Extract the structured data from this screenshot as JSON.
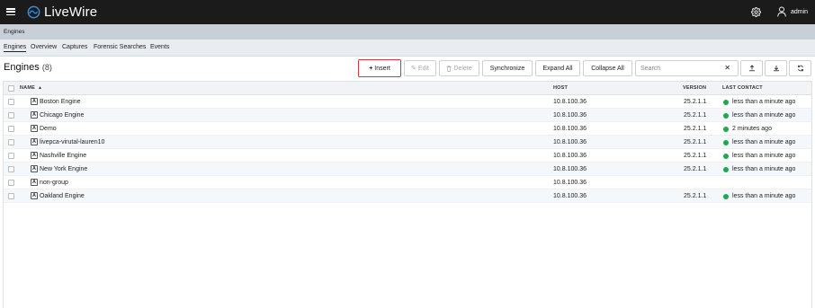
{
  "app": {
    "title": "LiveWire",
    "user": "admin"
  },
  "breadcrumb": "Engines",
  "tabs": [
    {
      "label": "Engines",
      "active": true
    },
    {
      "label": "Overview",
      "active": false
    },
    {
      "label": "Captures",
      "active": false
    },
    {
      "label": "Forensic Searches",
      "active": false
    },
    {
      "label": "Events",
      "active": false
    }
  ],
  "page": {
    "title": "Engines",
    "count": "(8)"
  },
  "toolbar": {
    "insert": "Insert",
    "edit": "Edit",
    "delete": "Delete",
    "synchronize": "Synchronize",
    "expand_all": "Expand All",
    "collapse_all": "Collapse All",
    "search_placeholder": "Search",
    "clear_glyph": "✕"
  },
  "columns": {
    "name": "NAME",
    "host": "HOST",
    "version": "VERSION",
    "last_contact": "LAST CONTACT"
  },
  "rows": [
    {
      "name": "Boston Engine",
      "host": "10.8.100.36",
      "version": "25.2.1.1",
      "last_contact": "less than a minute ago"
    },
    {
      "name": "Chicago Engine",
      "host": "10.8.100.36",
      "version": "25.2.1.1",
      "last_contact": "less than a minute ago"
    },
    {
      "name": "Demo",
      "host": "10.8.100.36",
      "version": "25.2.1.1",
      "last_contact": "2 minutes ago"
    },
    {
      "name": "livepca-virutal-lauren10",
      "host": "10.8.100.36",
      "version": "25.2.1.1",
      "last_contact": "less than a minute ago"
    },
    {
      "name": "Nashville Engine",
      "host": "10.8.100.36",
      "version": "25.2.1.1",
      "last_contact": "less than a minute ago"
    },
    {
      "name": "New York Engine",
      "host": "10.8.100.36",
      "version": "25.2.1.1",
      "last_contact": "less than a minute ago"
    },
    {
      "name": "non-group",
      "host": "10.8.100.36",
      "version": "",
      "last_contact": ""
    },
    {
      "name": "Oakland Engine",
      "host": "10.8.100.36",
      "version": "25.2.1.1",
      "last_contact": "less than a minute ago"
    }
  ],
  "icons": {
    "menu": "hamburger-icon",
    "logo": "livewire-logo",
    "settings": "gear-icon",
    "user": "user-icon",
    "insert": "plus-icon",
    "edit": "pencil-icon",
    "delete": "trash-icon",
    "upload": "upload-icon",
    "download": "download-icon",
    "refresh": "refresh-icon",
    "engine": "engine-icon",
    "status": "status-dot-icon"
  },
  "colors": {
    "topbar": "#1b1b1b",
    "brand_blue": "#2f8fe0",
    "status_green": "#1fa84f",
    "highlight_red": "#d9363e"
  }
}
